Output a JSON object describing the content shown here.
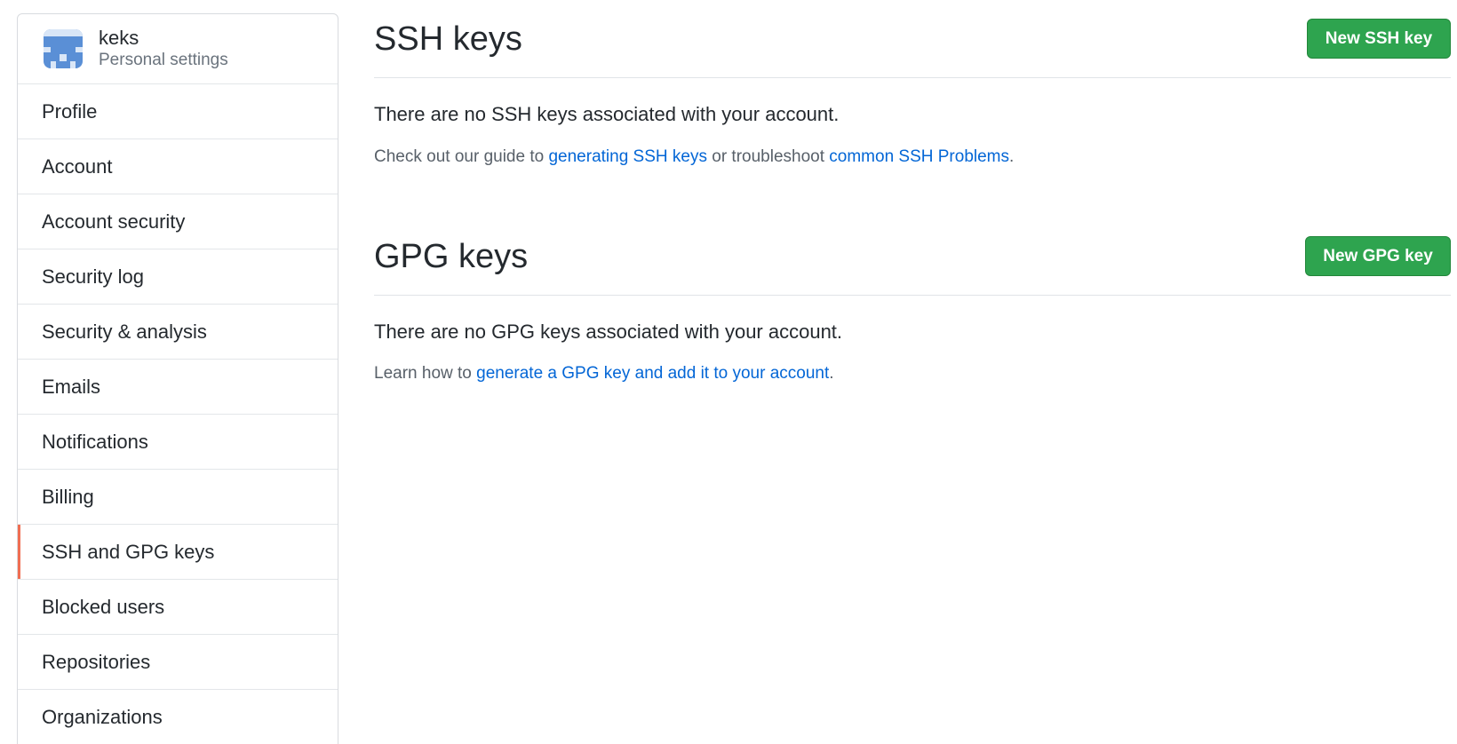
{
  "sidebar": {
    "user": {
      "name": "keks",
      "subtitle": "Personal settings"
    },
    "items": [
      {
        "label": "Profile",
        "selected": false
      },
      {
        "label": "Account",
        "selected": false
      },
      {
        "label": "Account security",
        "selected": false
      },
      {
        "label": "Security log",
        "selected": false
      },
      {
        "label": "Security & analysis",
        "selected": false
      },
      {
        "label": "Emails",
        "selected": false
      },
      {
        "label": "Notifications",
        "selected": false
      },
      {
        "label": "Billing",
        "selected": false
      },
      {
        "label": "SSH and GPG keys",
        "selected": true
      },
      {
        "label": "Blocked users",
        "selected": false
      },
      {
        "label": "Repositories",
        "selected": false
      },
      {
        "label": "Organizations",
        "selected": false
      }
    ],
    "accent_color": "#f06e52"
  },
  "ssh": {
    "title": "SSH keys",
    "button": "New SSH key",
    "empty": "There are no SSH keys associated with your account.",
    "help_prefix": "Check out our guide to ",
    "help_link1": "generating SSH keys",
    "help_middle": " or troubleshoot ",
    "help_link2": "common SSH Problems",
    "help_suffix": "."
  },
  "gpg": {
    "title": "GPG keys",
    "button": "New GPG key",
    "empty": "There are no GPG keys associated with your account.",
    "help_prefix": "Learn how to ",
    "help_link": "generate a GPG key and add it to your account",
    "help_suffix": "."
  },
  "colors": {
    "button_green": "#2ea44f",
    "link_blue": "#0366d6"
  }
}
